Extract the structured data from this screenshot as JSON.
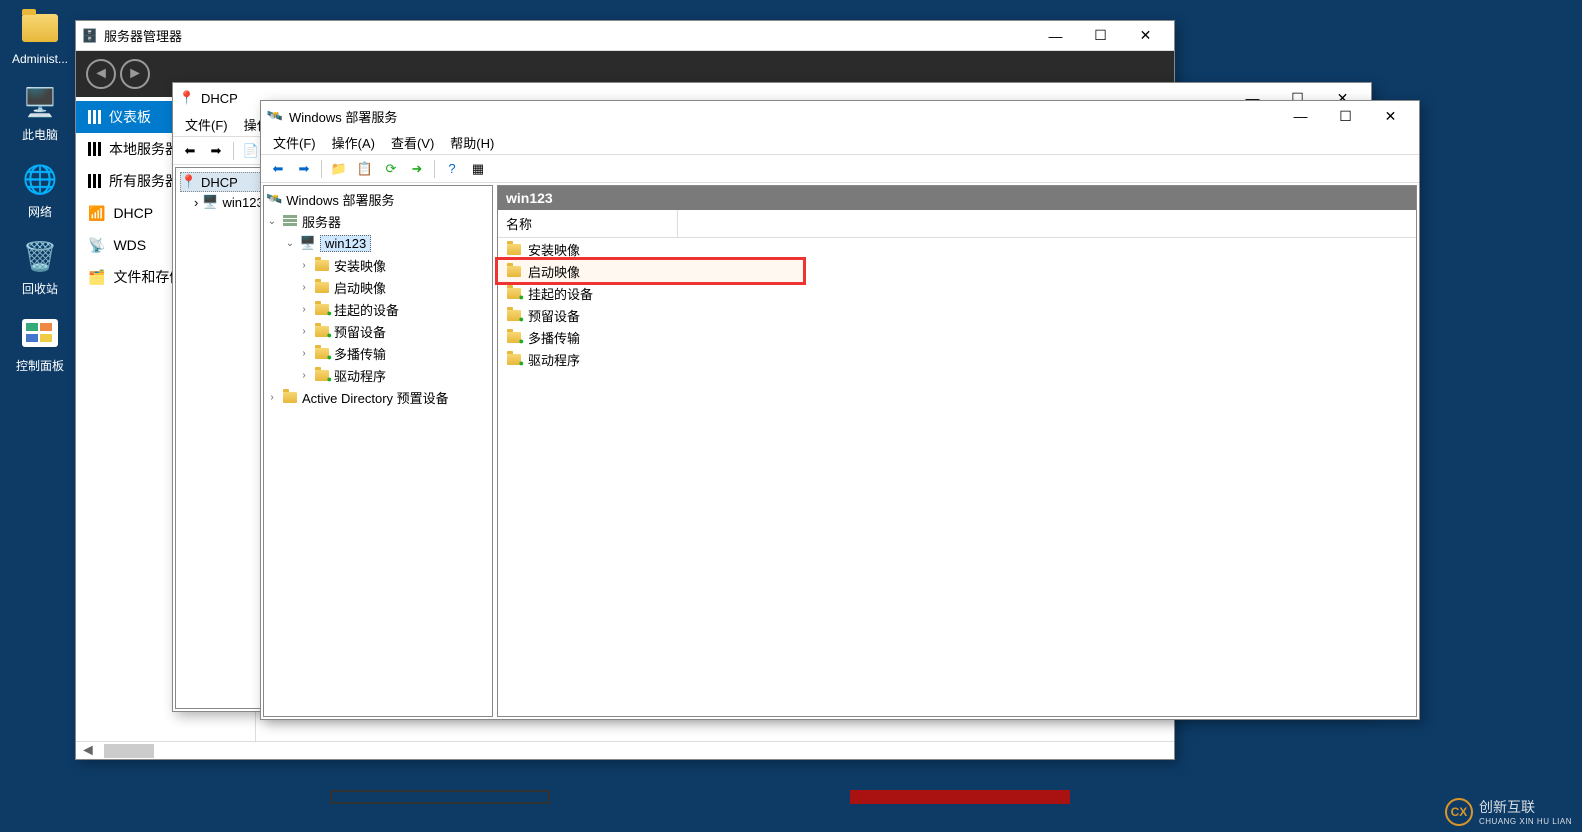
{
  "desktop": {
    "icons": [
      {
        "label": "Administ..."
      },
      {
        "label": "此电脑"
      },
      {
        "label": "网络"
      },
      {
        "label": "回收站"
      },
      {
        "label": "控制面板"
      }
    ]
  },
  "server_manager": {
    "title": "服务器管理器",
    "sidebar": [
      {
        "label": "仪表板"
      },
      {
        "label": "本地服务器"
      },
      {
        "label": "所有服务器"
      },
      {
        "label": "DHCP"
      },
      {
        "label": "WDS"
      },
      {
        "label": "文件和存储"
      }
    ]
  },
  "dhcp": {
    "title": "DHCP",
    "menu": {
      "file": "文件(F)",
      "action": "操作"
    },
    "tree": {
      "root": "DHCP",
      "child": "win123"
    }
  },
  "wds": {
    "title": "Windows 部署服务",
    "menu": {
      "file": "文件(F)",
      "action": "操作(A)",
      "view": "查看(V)",
      "help": "帮助(H)"
    },
    "tree": {
      "root": "Windows 部署服务",
      "servers": "服务器",
      "host": "win123",
      "children": [
        "安装映像",
        "启动映像",
        "挂起的设备",
        "预留设备",
        "多播传输",
        "驱动程序"
      ],
      "ad": "Active Directory 预置设备"
    },
    "right": {
      "header": "win123",
      "column": "名称",
      "items": [
        "安装映像",
        "启动映像",
        "挂起的设备",
        "预留设备",
        "多播传输",
        "驱动程序"
      ],
      "highlight_index": 1
    }
  },
  "watermark": {
    "brand": "创新互联",
    "sub": "CHUANG XIN HU LIAN"
  }
}
